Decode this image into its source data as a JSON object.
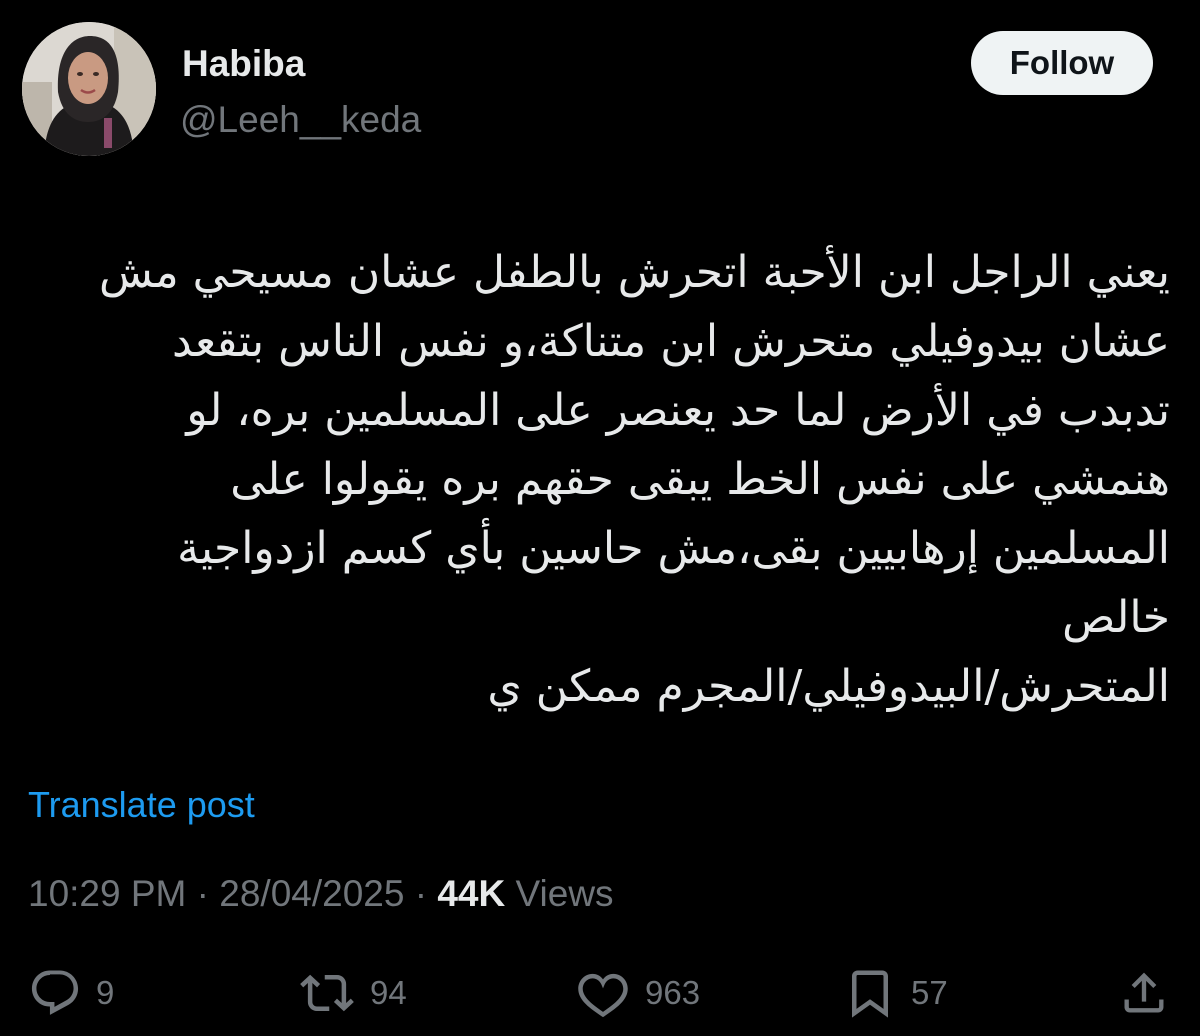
{
  "author": {
    "display_name": "Habiba",
    "handle": "@Leeh__keda"
  },
  "header": {
    "follow_label": "Follow"
  },
  "post": {
    "lines": [
      "يعني الراجل ابن الأحبة اتحرش بالطفل عشان مسيحي مش",
      "عشان بيدوفيلي متحرش ابن متناكة،و نفس الناس بتقعد",
      "تدبدب في الأرض لما حد يعنصر على المسلمين بره، لو",
      "هنمشي على نفس الخط يبقى حقهم بره يقولوا على",
      "المسلمين إرهابيين بقى،مش حاسين بأي كسم ازدواجية",
      "خالص",
      "المتحرش/البيدوفيلي/المجرم ممكن ي"
    ],
    "translate_label": "Translate post",
    "time": "10:29 PM",
    "date": "28/04/2025",
    "separator": "·",
    "views_count": "44K",
    "views_label": "Views"
  },
  "actions": {
    "replies": "9",
    "reposts": "94",
    "likes": "963",
    "bookmarks": "57"
  },
  "colors": {
    "background": "#000000",
    "text": "#e7e9ea",
    "secondary": "#71767b",
    "link": "#1d9bf0",
    "button_bg": "#eff3f4"
  }
}
